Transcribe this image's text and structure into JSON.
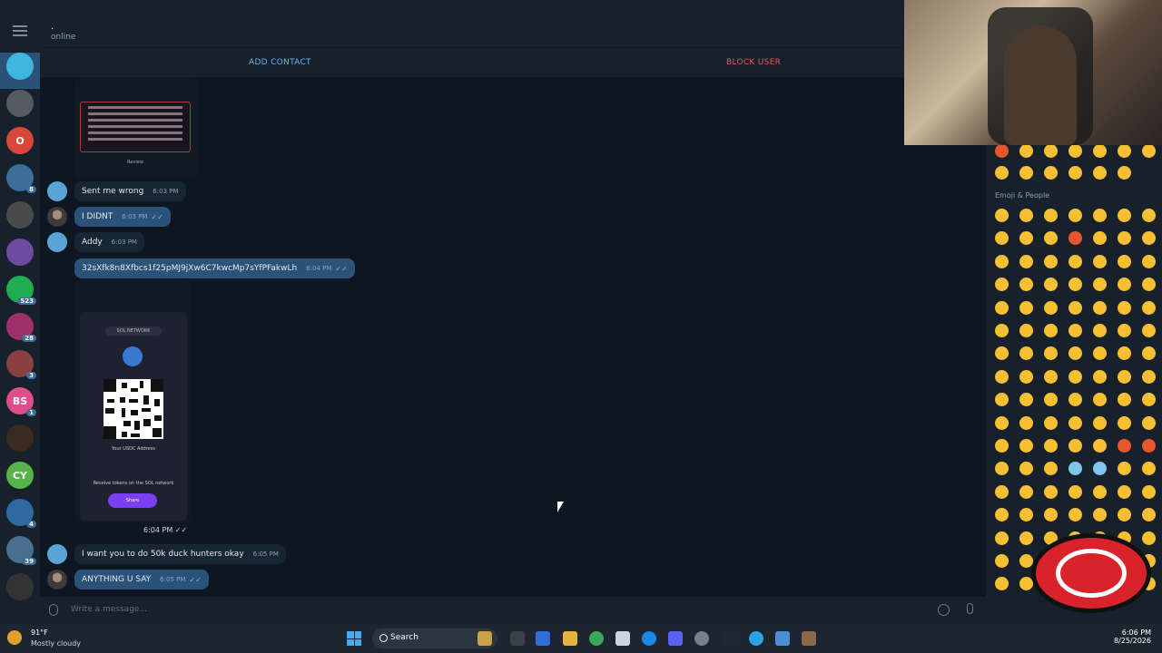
{
  "chat": {
    "name": ".",
    "status": "online",
    "add_contact": "ADD CONTACT",
    "block_user": "BLOCK USER",
    "composer_placeholder": "Write a message..."
  },
  "sidebar": {
    "avatars": [
      {
        "initials": "",
        "color": "#3fb6e0",
        "badge": ""
      },
      {
        "initials": "",
        "color": "#555a60",
        "badge": ""
      },
      {
        "initials": "O",
        "color": "#d9473b",
        "badge": ""
      },
      {
        "initials": "",
        "color": "#3d6e9a",
        "badge": "8"
      },
      {
        "initials": "",
        "color": "#4a4a4a",
        "badge": ""
      },
      {
        "initials": "",
        "color": "#6b4aa0",
        "badge": ""
      },
      {
        "initials": "",
        "color": "#1fae4f",
        "badge": "523"
      },
      {
        "initials": "",
        "color": "#a0306a",
        "badge": "28"
      },
      {
        "initials": "",
        "color": "#8a4040",
        "badge": "3"
      },
      {
        "initials": "BS",
        "color": "#e04e8a",
        "badge": "1"
      },
      {
        "initials": "",
        "color": "#3a2a20",
        "badge": ""
      },
      {
        "initials": "CY",
        "color": "#57b24a",
        "badge": ""
      },
      {
        "initials": "",
        "color": "#2e6aa0",
        "badge": "4"
      },
      {
        "initials": "",
        "color": "#4a6f8e",
        "badge": "39"
      },
      {
        "initials": "",
        "color": "#333",
        "badge": ""
      }
    ]
  },
  "messages": [
    {
      "type": "in",
      "avatar": "blue",
      "text": "Sent me wrong",
      "time": "6:03 PM",
      "check": ""
    },
    {
      "type": "out",
      "avatar": "photo",
      "text": "I DIDNT",
      "time": "6:03 PM",
      "check": "✓✓"
    },
    {
      "type": "in",
      "avatar": "blue",
      "text": "Addy",
      "time": "6:03 PM",
      "check": ""
    },
    {
      "type": "out",
      "avatar": "none",
      "text": "32sXfk8n8Xfbcs1f25pMJ9jXw6C7kwcMp7sYfPFakwLh",
      "time": "6:04 PM",
      "check": "✓✓"
    },
    {
      "type": "in",
      "avatar": "blue",
      "text": "I want you to do 50k duck hunters okay",
      "time": "6:05 PM",
      "check": ""
    },
    {
      "type": "out",
      "avatar": "photo",
      "text": "ANYTHING U SAY",
      "time": "6:05 PM",
      "check": "✓✓"
    }
  ],
  "image_message": {
    "review_label": "Review",
    "network": "SOL NETWORK",
    "address_title": "Your USDC Address",
    "note": "Receive tokens on the SOL network",
    "share": "Share",
    "time": "6:04 PM ✓✓"
  },
  "emoji_panel": {
    "section": "Emoji & People"
  },
  "taskbar": {
    "temp": "91°F",
    "weather": "Mostly cloudy",
    "search": "Search",
    "time": "6:06 PM",
    "date": "8/25/2026"
  }
}
